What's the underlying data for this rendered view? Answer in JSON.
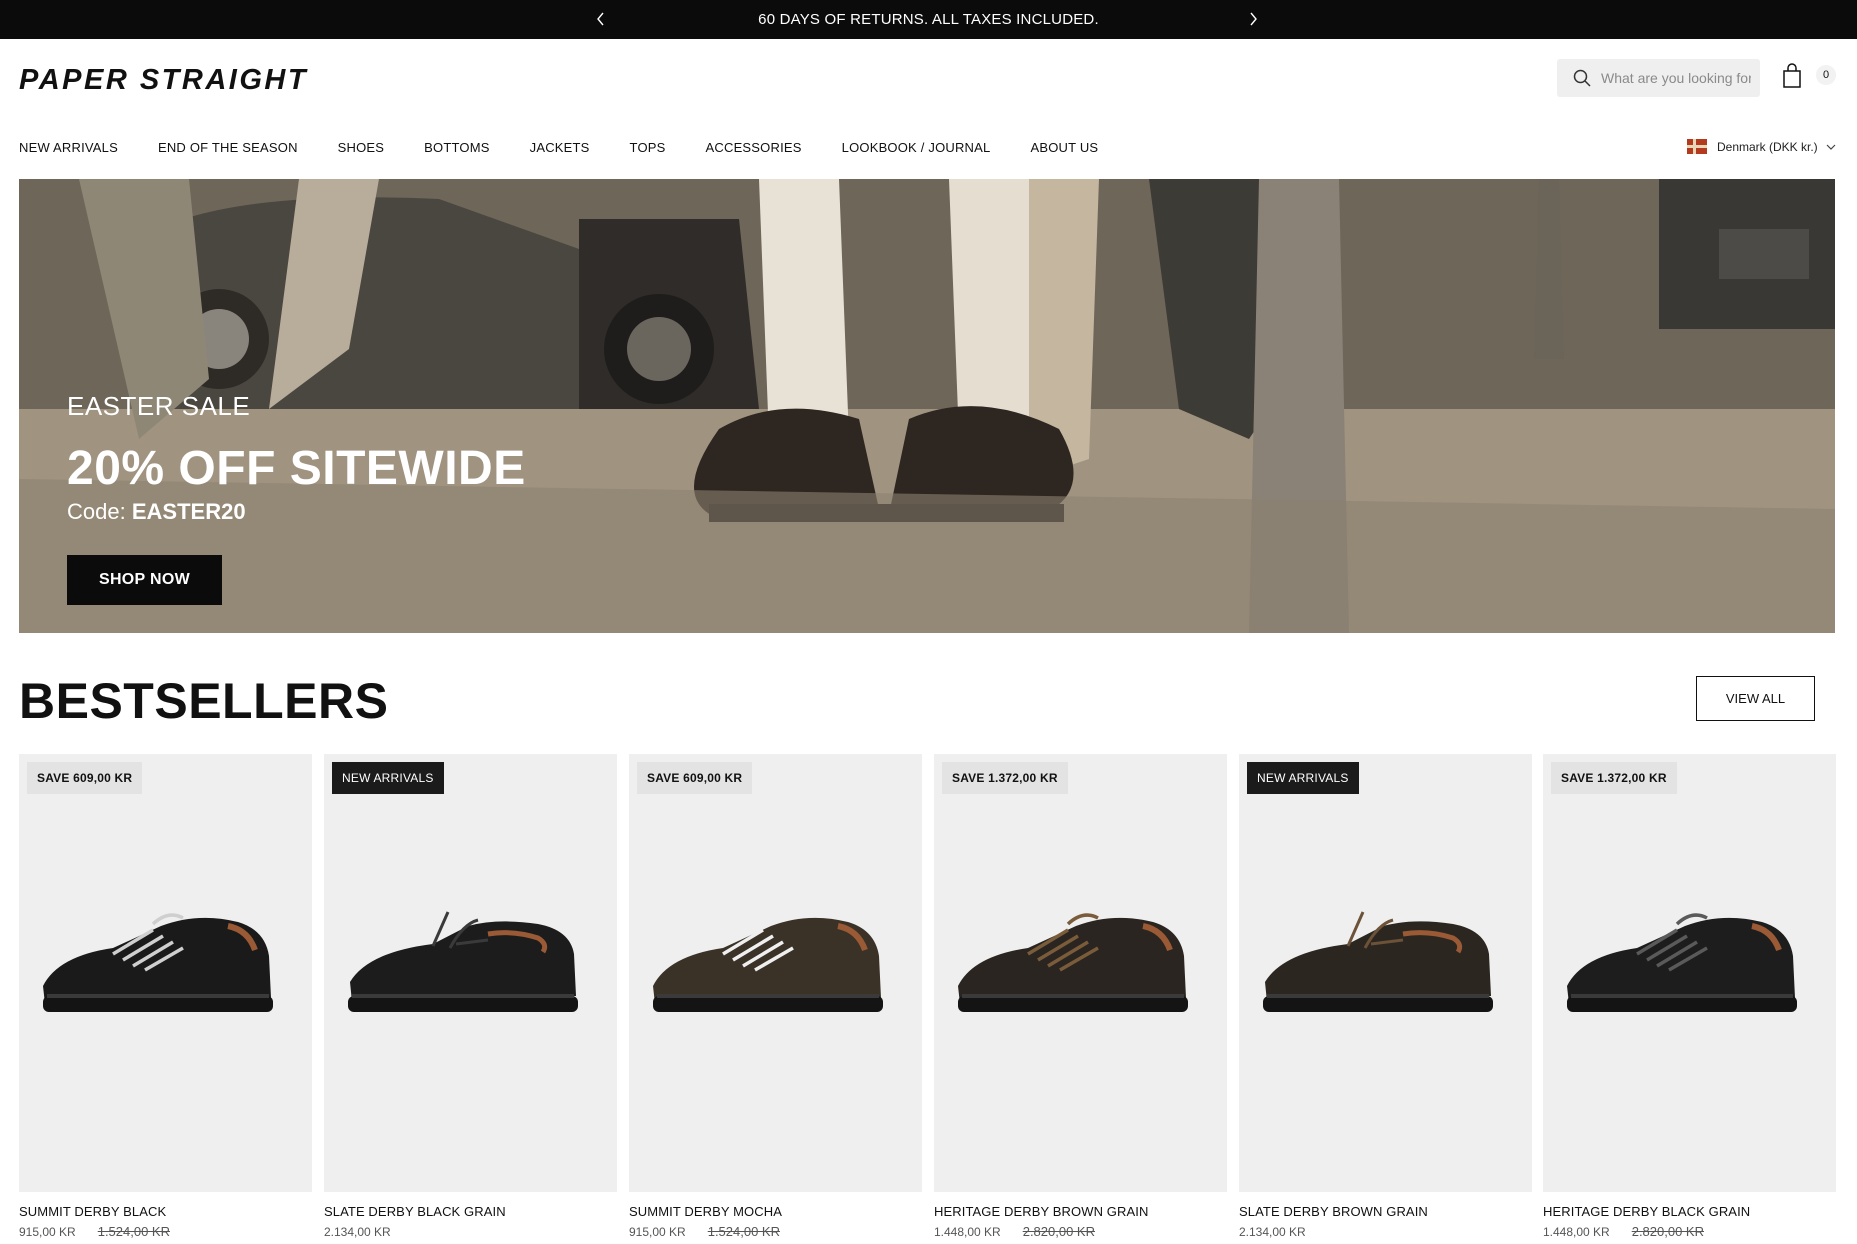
{
  "announcement": {
    "text": "60 DAYS OF RETURNS. ALL TAXES INCLUDED."
  },
  "header": {
    "logo": "PAPER STRAIGHT",
    "search_placeholder": "What are you looking for",
    "cart_count": "0"
  },
  "nav": {
    "items": [
      {
        "label": "NEW ARRIVALS"
      },
      {
        "label": "END OF THE SEASON"
      },
      {
        "label": "SHOES"
      },
      {
        "label": "BOTTOMS"
      },
      {
        "label": "JACKETS"
      },
      {
        "label": "TOPS"
      },
      {
        "label": "ACCESSORIES"
      },
      {
        "label": "LOOKBOOK / JOURNAL"
      },
      {
        "label": "ABOUT US"
      }
    ],
    "locale": "Denmark (DKK kr.)"
  },
  "hero": {
    "eyebrow": "EASTER SALE",
    "headline": "20% OFF SITEWIDE",
    "code_label": "Code:",
    "code_value": "EASTER20",
    "cta": "SHOP NOW"
  },
  "bestsellers": {
    "title": "BESTSELLERS",
    "view_all": "VIEW ALL",
    "products": [
      {
        "badge": "SAVE 609,00 KR",
        "badge_type": "save",
        "name": "SUMMIT DERBY BLACK",
        "price": "915,00 KR",
        "old_price": "1.524,00 KR",
        "shoe_color": "#1a1a1a",
        "lace_color": "#cfcfcf",
        "style": "hiker"
      },
      {
        "badge": "NEW ARRIVALS",
        "badge_type": "new",
        "name": "SLATE DERBY BLACK GRAIN",
        "price": "2.134,00 KR",
        "old_price": "",
        "shoe_color": "#1c1c1c",
        "lace_color": "#3a3a3a",
        "style": "moc"
      },
      {
        "badge": "SAVE 609,00 KR",
        "badge_type": "save",
        "name": "SUMMIT DERBY MOCHA",
        "price": "915,00 KR",
        "old_price": "1.524,00 KR",
        "shoe_color": "#3a3127",
        "lace_color": "#efefef",
        "style": "hiker"
      },
      {
        "badge": "SAVE 1.372,00 KR",
        "badge_type": "save",
        "name": "HERITAGE DERBY BROWN GRAIN",
        "price": "1.448,00 KR",
        "old_price": "2.820,00 KR",
        "shoe_color": "#2a2520",
        "lace_color": "#7a5c3a",
        "style": "heritage"
      },
      {
        "badge": "NEW ARRIVALS",
        "badge_type": "new",
        "name": "SLATE DERBY BROWN GRAIN",
        "price": "2.134,00 KR",
        "old_price": "",
        "shoe_color": "#2b2620",
        "lace_color": "#6b5238",
        "style": "moc"
      },
      {
        "badge": "SAVE 1.372,00 KR",
        "badge_type": "save",
        "name": "HERITAGE DERBY BLACK GRAIN",
        "price": "1.448,00 KR",
        "old_price": "2.820,00 KR",
        "shoe_color": "#1d1d1d",
        "lace_color": "#5a5a5a",
        "style": "heritage"
      }
    ]
  }
}
